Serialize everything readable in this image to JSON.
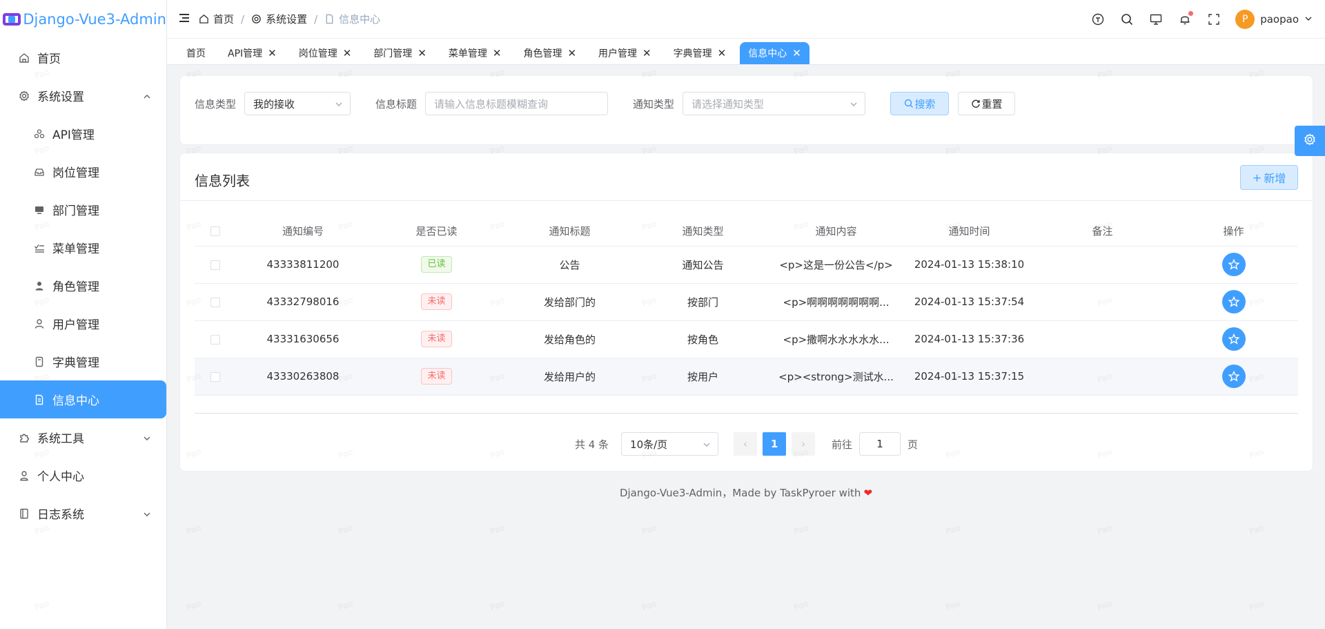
{
  "app": {
    "title": "Django-Vue3-Admin"
  },
  "sidebar": {
    "items": [
      {
        "label": "首页",
        "icon": "home-icon"
      },
      {
        "label": "系统设置",
        "icon": "gear-icon"
      },
      {
        "label": "API管理",
        "icon": "api-icon"
      },
      {
        "label": "岗位管理",
        "icon": "post-icon"
      },
      {
        "label": "部门管理",
        "icon": "monitor-icon"
      },
      {
        "label": "菜单管理",
        "icon": "checklist-icon"
      },
      {
        "label": "角色管理",
        "icon": "role-icon"
      },
      {
        "label": "用户管理",
        "icon": "user-icon"
      },
      {
        "label": "字典管理",
        "icon": "dictionary-icon"
      },
      {
        "label": "信息中心",
        "icon": "document-icon"
      },
      {
        "label": "系统工具",
        "icon": "puzzle-icon"
      },
      {
        "label": "个人中心",
        "icon": "person-icon"
      },
      {
        "label": "日志系统",
        "icon": "notebook-icon"
      }
    ]
  },
  "breadcrumb": {
    "home": "首页",
    "settings": "系统设置",
    "current": "信息中心"
  },
  "user": {
    "avatar_letter": "P",
    "name": "paopao"
  },
  "tabs": [
    "首页",
    "API管理",
    "岗位管理",
    "部门管理",
    "菜单管理",
    "角色管理",
    "用户管理",
    "字典管理",
    "信息中心"
  ],
  "search": {
    "type_label": "信息类型",
    "type_value": "我的接收",
    "title_label": "信息标题",
    "title_placeholder": "请输入信息标题模糊查询",
    "notice_label": "通知类型",
    "notice_placeholder": "请选择通知类型",
    "search_btn": "搜索",
    "reset_btn": "重置"
  },
  "list": {
    "title": "信息列表",
    "add_btn": "新增",
    "columns": [
      "通知编号",
      "是否已读",
      "通知标题",
      "通知类型",
      "通知内容",
      "通知时间",
      "备注",
      "操作"
    ],
    "rows": [
      {
        "id": "43333811200",
        "read": "已读",
        "title": "公告",
        "type": "通知公告",
        "content": "<p>这是一份公告</p>",
        "time": "2024-01-13 15:38:10",
        "note": ""
      },
      {
        "id": "43332798016",
        "read": "未读",
        "title": "发给部门的",
        "type": "按部门",
        "content": "<p>啊啊啊啊啊啊啊...",
        "time": "2024-01-13 15:37:54",
        "note": ""
      },
      {
        "id": "43331630656",
        "read": "未读",
        "title": "发给角色的",
        "type": "按角色",
        "content": "<p>撒啊水水水水水...",
        "time": "2024-01-13 15:37:36",
        "note": ""
      },
      {
        "id": "43330263808",
        "read": "未读",
        "title": "发给用户的",
        "type": "按用户",
        "content": "<p><strong>测试水...",
        "time": "2024-01-13 15:37:15",
        "note": ""
      }
    ]
  },
  "pagination": {
    "total_text": "共 4 条",
    "page_size": "10条/页",
    "current_page": "1",
    "goto_prefix": "前往",
    "goto_value": "1",
    "goto_suffix": "页"
  },
  "footer": {
    "text": "Django-Vue3-Admin，Made by TaskPyroer with"
  },
  "watermark": "Pao",
  "colors": {
    "primary": "#409eff",
    "danger": "#f56c6c",
    "success": "#67c23a"
  }
}
